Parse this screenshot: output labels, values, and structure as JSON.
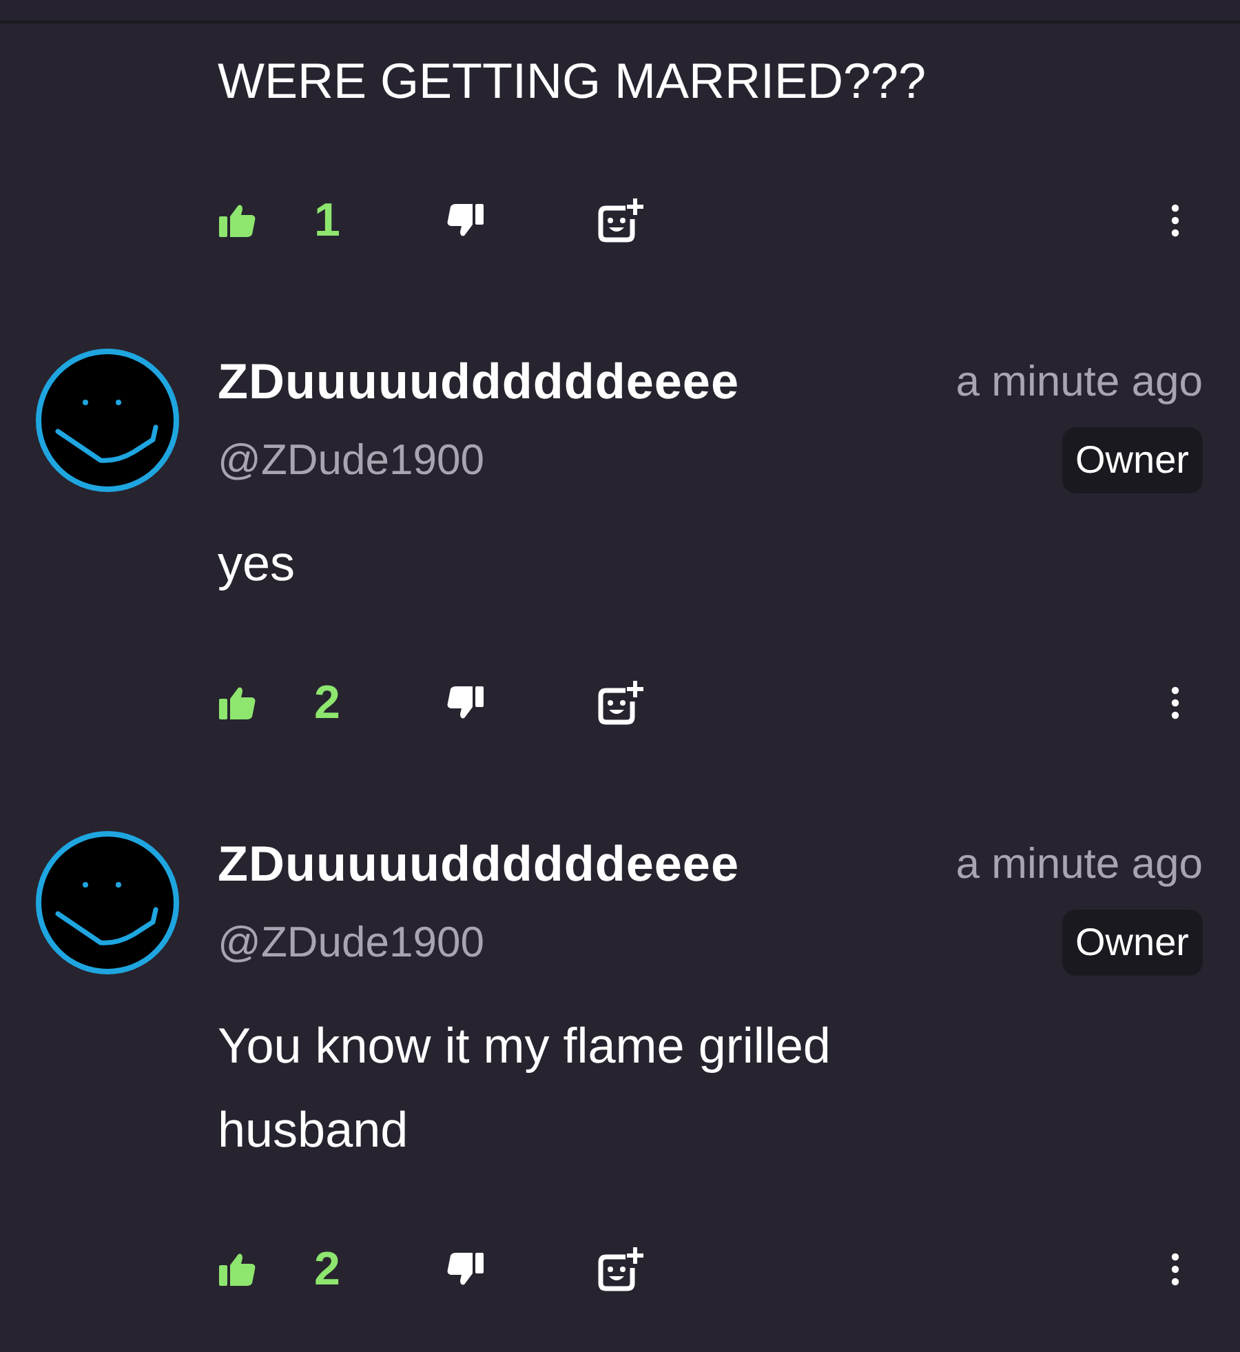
{
  "comments": [
    {
      "body": "WERE GETTING MARRIED???",
      "likes": "1",
      "liked": true
    },
    {
      "author": {
        "name": "ZDuuuuuddddddeeee",
        "handle": "@ZDude1900",
        "time": "a minute ago",
        "badge": "Owner"
      },
      "body": "yes",
      "likes": "2",
      "liked": true
    },
    {
      "author": {
        "name": "ZDuuuuuddddddeeee",
        "handle": "@ZDude1900",
        "time": "a minute ago",
        "badge": "Owner"
      },
      "body": "You know it my flame grilled husband",
      "likes": "2",
      "liked": true
    }
  ]
}
